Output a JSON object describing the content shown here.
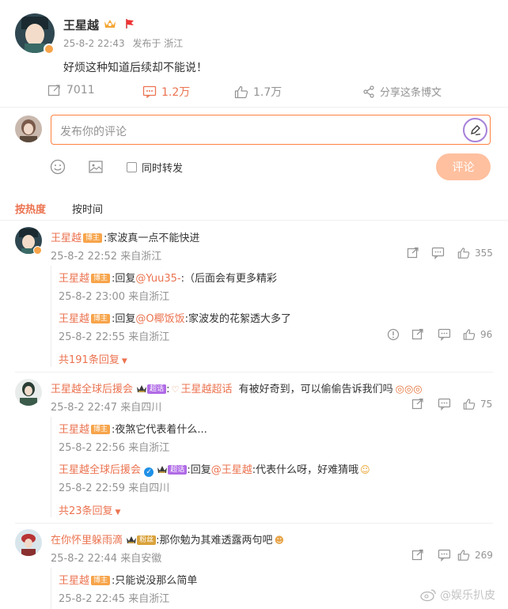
{
  "post": {
    "author": "王星越",
    "time": "25-8-2 22:43",
    "source": "发布于 浙江",
    "text": "好烦这种知道后续却不能说！",
    "repost_count": "7011",
    "comment_count": "1.2万",
    "like_count": "1.7万",
    "share_label": "分享这条博文"
  },
  "composer": {
    "placeholder": "发布你的评论",
    "also_repost": "同时转发",
    "submit": "评论"
  },
  "sort": {
    "hot": "按热度",
    "time": "按时间"
  },
  "badges": {
    "bozhu": "博主",
    "superfan": "超话",
    "fan": "粉丝"
  },
  "comments": [
    {
      "user": "王星越",
      "text": ":家波真一点不能快进",
      "meta": "25-8-2 22:52 来自浙江",
      "likes": "355",
      "replies": [
        {
          "user": "王星越",
          "pre": ":回复",
          "mention": "@Yuu35-",
          "text": ":（后面会有更多精彩",
          "meta": "25-8-2 23:00 来自浙江"
        },
        {
          "user": "王星越",
          "pre": ":回复",
          "mention": "@O椰饭饭",
          "text": ":家波发的花絮透大多了",
          "meta": "25-8-2 22:55 来自浙江",
          "likes": "96"
        }
      ],
      "more": "共191条回复"
    },
    {
      "user": "王星越全球后援会",
      "mention": "王星越超话",
      "text": "有被好奇到，可以偷偷告诉我们吗",
      "meta": "25-8-2 22:47 来自四川",
      "likes": "75",
      "replies": [
        {
          "user": "王星越",
          "pre": "",
          "mention": "",
          "text": ":夜煞它代表着什么...",
          "meta": "25-8-2 22:56 来自浙江"
        },
        {
          "user": "王星越全球后援会",
          "pre": ":回复",
          "mention": "@王星越",
          "text": ":代表什么呀，好难猜哦",
          "meta": "25-8-2 22:59 来自四川"
        }
      ],
      "more": "共23条回复"
    },
    {
      "user": "在你怀里躲雨滴",
      "text": ":那你勉为其难透露两句吧",
      "meta": "25-8-2 22:44 来自安徽",
      "likes": "269",
      "replies": [
        {
          "user": "王星越",
          "pre": "",
          "mention": "",
          "text": ":只能说没那么简单",
          "meta": "25-8-2 22:45 来自浙江"
        }
      ]
    }
  ],
  "watermark": "@娱乐扒皮",
  "colors": {
    "accent": "#eb7350",
    "submit_bg": "#ffc09f",
    "link": "#eb7350"
  }
}
